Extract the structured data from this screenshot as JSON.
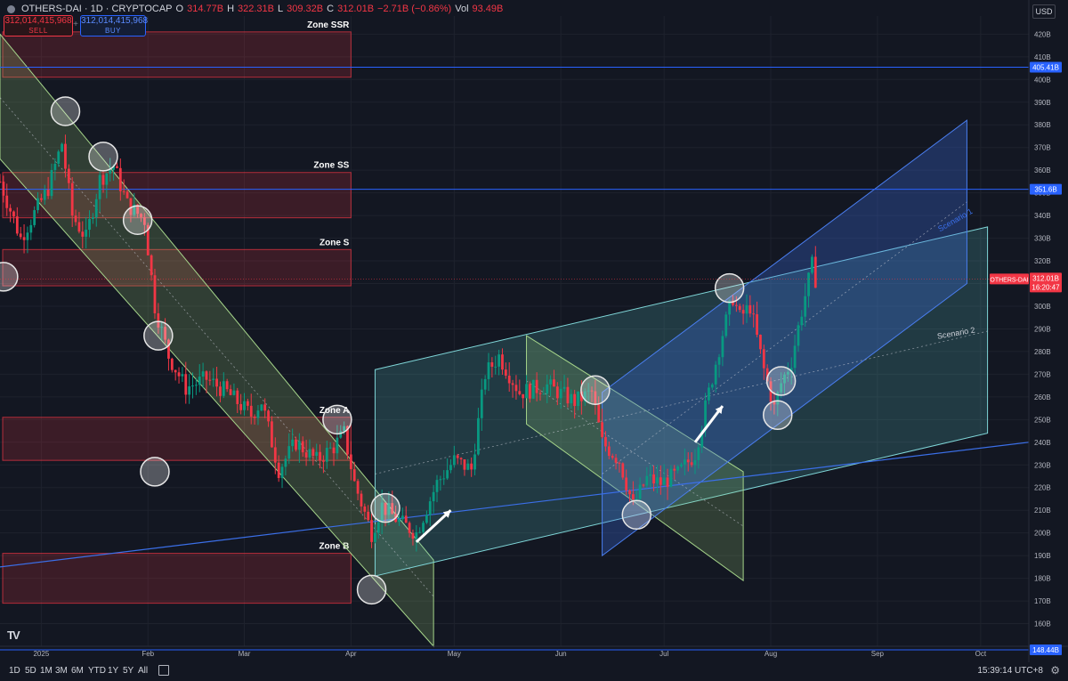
{
  "header": {
    "symbol": "OTHERS-DAI · 1D · CRYPTOCAP",
    "open_label": "O",
    "open": "314.77B",
    "high_label": "H",
    "high": "322.31B",
    "low_label": "L",
    "low": "309.32B",
    "close_label": "C",
    "close": "312.01B",
    "change": "−2.71B (−0.86%)",
    "vol_label": "Vol",
    "vol": "93.49B"
  },
  "trade": {
    "sell_value": "312,014,415,968",
    "sell_label": "SELL",
    "buy_value": "312,014,415,968",
    "buy_label": "BUY",
    "plus": "+"
  },
  "currency": "USD",
  "colors": {
    "background": "#131722",
    "up": "#089981",
    "down": "#f23645",
    "zone_fill": "rgba(242,54,69,0.18)",
    "zone_stroke": "#f23645",
    "green_channel": "rgba(154,205,120,0.22)",
    "cyan_channel": "rgba(90,200,200,0.20)",
    "blue_channel": "rgba(60,110,230,0.30)",
    "horizontal_line": "#2962ff"
  },
  "toolbar": {
    "timeframes": [
      "1D",
      "5D",
      "1M",
      "3M",
      "6M",
      "YTD",
      "1Y",
      "5Y",
      "All"
    ],
    "clock": "15:39:14 UTC+8",
    "calendar_icon": "calendar-icon",
    "settings_icon": "gear-icon"
  },
  "chart_data": {
    "type": "candlestick",
    "y_unit": "B",
    "ylim": [
      150,
      428
    ],
    "xlim": [
      "2024-12-20",
      "2025-10-15"
    ],
    "y_ticks": [
      "160B",
      "170B",
      "180B",
      "190B",
      "200B",
      "210B",
      "220B",
      "230B",
      "240B",
      "250B",
      "260B",
      "270B",
      "280B",
      "290B",
      "300B",
      "310B",
      "320B",
      "330B",
      "340B",
      "350B",
      "360B",
      "370B",
      "380B",
      "390B",
      "400B",
      "410B",
      "420B"
    ],
    "x_ticks": [
      {
        "label": "2025",
        "date": "2025-01-01"
      },
      {
        "label": "Feb",
        "date": "2025-02-01"
      },
      {
        "label": "Mar",
        "date": "2025-03-01"
      },
      {
        "label": "Apr",
        "date": "2025-04-01"
      },
      {
        "label": "May",
        "date": "2025-05-01"
      },
      {
        "label": "Jun",
        "date": "2025-06-01"
      },
      {
        "label": "Jul",
        "date": "2025-07-01"
      },
      {
        "label": "Aug",
        "date": "2025-08-01"
      },
      {
        "label": "Sep",
        "date": "2025-09-01"
      },
      {
        "label": "Oct",
        "date": "2025-10-01"
      }
    ],
    "price_anchors": [
      [
        "2024-12-20",
        355
      ],
      [
        "2024-12-26",
        330
      ],
      [
        "2025-01-03",
        352
      ],
      [
        "2025-01-07",
        372
      ],
      [
        "2025-01-10",
        340
      ],
      [
        "2025-01-14",
        330
      ],
      [
        "2025-01-18",
        356
      ],
      [
        "2025-01-22",
        362
      ],
      [
        "2025-01-26",
        345
      ],
      [
        "2025-01-31",
        338
      ],
      [
        "2025-02-03",
        300
      ],
      [
        "2025-02-07",
        278
      ],
      [
        "2025-02-12",
        264
      ],
      [
        "2025-02-18",
        268
      ],
      [
        "2025-02-24",
        262
      ],
      [
        "2025-03-03",
        252
      ],
      [
        "2025-03-06",
        258
      ],
      [
        "2025-03-11",
        228
      ],
      [
        "2025-03-16",
        240
      ],
      [
        "2025-03-22",
        232
      ],
      [
        "2025-03-27",
        238
      ],
      [
        "2025-03-30",
        244
      ],
      [
        "2025-04-02",
        222
      ],
      [
        "2025-04-07",
        200
      ],
      [
        "2025-04-10",
        212
      ],
      [
        "2025-04-15",
        205
      ],
      [
        "2025-04-20",
        200
      ],
      [
        "2025-04-26",
        222
      ],
      [
        "2025-05-01",
        232
      ],
      [
        "2025-05-06",
        228
      ],
      [
        "2025-05-10",
        270
      ],
      [
        "2025-05-14",
        278
      ],
      [
        "2025-05-20",
        262
      ],
      [
        "2025-05-28",
        265
      ],
      [
        "2025-06-05",
        258
      ],
      [
        "2025-06-10",
        262
      ],
      [
        "2025-06-13",
        240
      ],
      [
        "2025-06-18",
        232
      ],
      [
        "2025-06-22",
        212
      ],
      [
        "2025-06-26",
        224
      ],
      [
        "2025-06-30",
        222
      ],
      [
        "2025-07-05",
        226
      ],
      [
        "2025-07-10",
        235
      ],
      [
        "2025-07-14",
        262
      ],
      [
        "2025-07-18",
        288
      ],
      [
        "2025-07-21",
        304
      ],
      [
        "2025-07-23",
        295
      ],
      [
        "2025-07-26",
        300
      ],
      [
        "2025-07-30",
        272
      ],
      [
        "2025-08-02",
        255
      ],
      [
        "2025-08-04",
        266
      ],
      [
        "2025-08-07",
        276
      ],
      [
        "2025-08-10",
        298
      ],
      [
        "2025-08-13",
        318
      ],
      [
        "2025-08-14",
        312.01
      ]
    ],
    "last_price": {
      "label": "OTHERS-DAI",
      "value": "312.01B",
      "countdown": "16:20:47",
      "y": 312.01
    },
    "horizontal_levels": [
      {
        "value": 405.41,
        "label": "405.41B"
      },
      {
        "value": 351.6,
        "label": "351.6B"
      },
      {
        "value": 148.44,
        "label": "148.44B"
      }
    ],
    "zones": [
      {
        "name": "Zone SSR",
        "top": 421,
        "bottom": 401
      },
      {
        "name": "Zone SS",
        "top": 359,
        "bottom": 339
      },
      {
        "name": "Zone S",
        "top": 325,
        "bottom": 309
      },
      {
        "name": "Zone A",
        "top": 251,
        "bottom": 232
      },
      {
        "name": "Zone B",
        "top": 191,
        "bottom": 169
      }
    ],
    "zone_x": [
      "2024-12-20",
      "2025-04-01"
    ],
    "channels": [
      {
        "kind": "green",
        "points": [
          [
            "2024-12-20",
            420
          ],
          [
            "2025-04-25",
            188
          ],
          [
            "2025-04-25",
            150
          ],
          [
            "2024-12-20",
            365
          ]
        ]
      },
      {
        "kind": "cyan",
        "points": [
          [
            "2025-04-08",
            272
          ],
          [
            "2025-10-03",
            335
          ],
          [
            "2025-10-03",
            244
          ],
          [
            "2025-04-08",
            181
          ]
        ]
      },
      {
        "kind": "green",
        "points": [
          [
            "2025-05-22",
            287
          ],
          [
            "2025-07-24",
            227
          ],
          [
            "2025-07-24",
            179
          ],
          [
            "2025-05-22",
            248
          ]
        ]
      },
      {
        "kind": "blue",
        "points": [
          [
            "2025-06-13",
            262
          ],
          [
            "2025-09-27",
            382
          ],
          [
            "2025-09-27",
            310
          ],
          [
            "2025-06-13",
            190
          ]
        ]
      }
    ],
    "rising_line": [
      [
        "2024-12-20",
        185
      ],
      [
        "2025-10-15",
        240
      ]
    ],
    "midlines": [
      [
        [
          "2024-12-20",
          392
        ],
        [
          "2025-04-25",
          172
        ]
      ],
      [
        [
          "2025-04-08",
          226
        ],
        [
          "2025-10-03",
          289
        ]
      ],
      [
        [
          "2025-05-22",
          267
        ],
        [
          "2025-07-24",
          203
        ]
      ],
      [
        [
          "2025-06-13",
          226
        ],
        [
          "2025-09-27",
          346
        ]
      ]
    ],
    "scenario_labels": [
      {
        "text": "Scenario 1",
        "x": "2025-09-24",
        "y": 337
      },
      {
        "text": "Scenario 2",
        "x": "2025-09-24",
        "y": 287
      }
    ],
    "circles": [
      [
        "2024-12-21",
        313
      ],
      [
        "2025-01-08",
        386
      ],
      [
        "2025-01-19",
        366
      ],
      [
        "2025-01-29",
        338
      ],
      [
        "2025-02-04",
        287
      ],
      [
        "2025-02-03",
        227
      ],
      [
        "2025-03-28",
        250
      ],
      [
        "2025-04-11",
        211
      ],
      [
        "2025-04-07",
        175
      ],
      [
        "2025-06-11",
        263
      ],
      [
        "2025-06-23",
        208
      ],
      [
        "2025-07-20",
        308
      ],
      [
        "2025-08-04",
        267
      ],
      [
        "2025-08-03",
        252
      ]
    ],
    "arrows": [
      [
        [
          "2025-04-20",
          196
        ],
        [
          "2025-04-30",
          210
        ]
      ],
      [
        [
          "2025-07-10",
          240
        ],
        [
          "2025-07-18",
          256
        ]
      ]
    ]
  }
}
